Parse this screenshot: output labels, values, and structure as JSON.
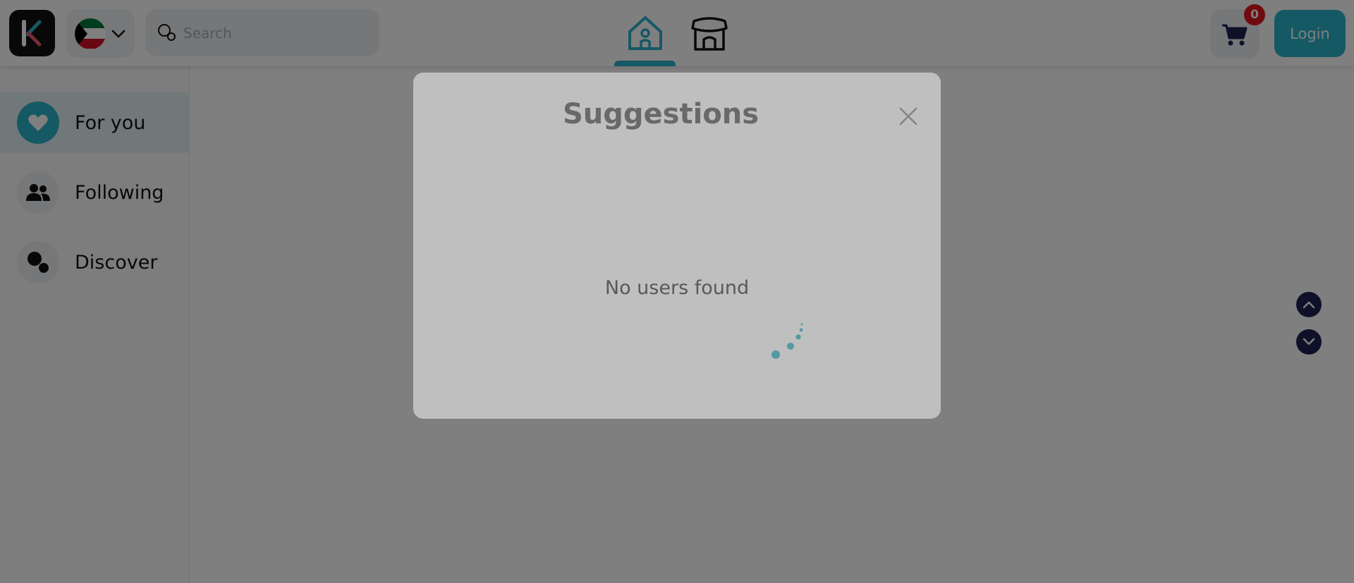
{
  "header": {
    "logo_alt": "logo-icon",
    "country": {
      "name": "Kuwait",
      "flag_icon": "kuwait-flag-icon",
      "chevron_icon": "chevron-down-icon"
    },
    "search": {
      "placeholder": "Search",
      "value": ""
    },
    "nav": [
      {
        "name": "home",
        "icon": "home-icon",
        "active": true
      },
      {
        "name": "store",
        "icon": "store-icon",
        "active": false
      }
    ],
    "cart": {
      "icon": "cart-icon",
      "count": "0"
    },
    "login_label": "Login"
  },
  "sidebar": {
    "items": [
      {
        "label": "For you",
        "icon": "heart-icon",
        "active": true
      },
      {
        "label": "Following",
        "icon": "users-icon",
        "active": false
      },
      {
        "label": "Discover",
        "icon": "discover-icon",
        "active": false
      }
    ]
  },
  "modal": {
    "title": "Suggestions",
    "empty_text": "No users found"
  },
  "colors": {
    "accent": "#2ab3c8",
    "badge": "#e0141c",
    "scroll_button": "#1c2350",
    "overlay": "rgba(0,0,0,0.5)"
  }
}
